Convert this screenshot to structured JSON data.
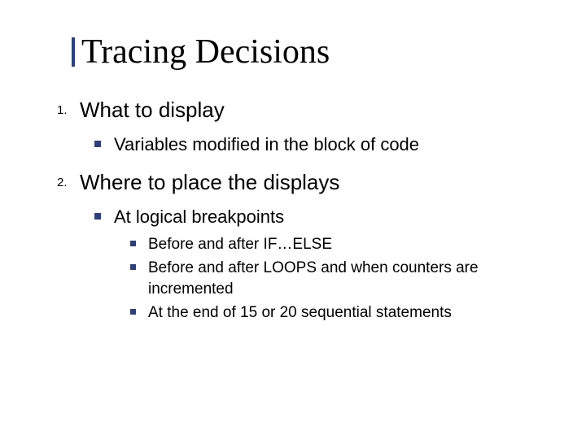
{
  "title": "Tracing Decisions",
  "points": {
    "p1": {
      "label": "What to display",
      "sub1": "Variables modified in the block of code"
    },
    "p2": {
      "label": "Where to place the displays",
      "sub1": "At logical breakpoints",
      "detail1": "Before and after IF…ELSE",
      "detail2": "Before and after LOOPS and when counters are incremented",
      "detail3": "At the end of 15 or 20 sequential statements"
    }
  }
}
